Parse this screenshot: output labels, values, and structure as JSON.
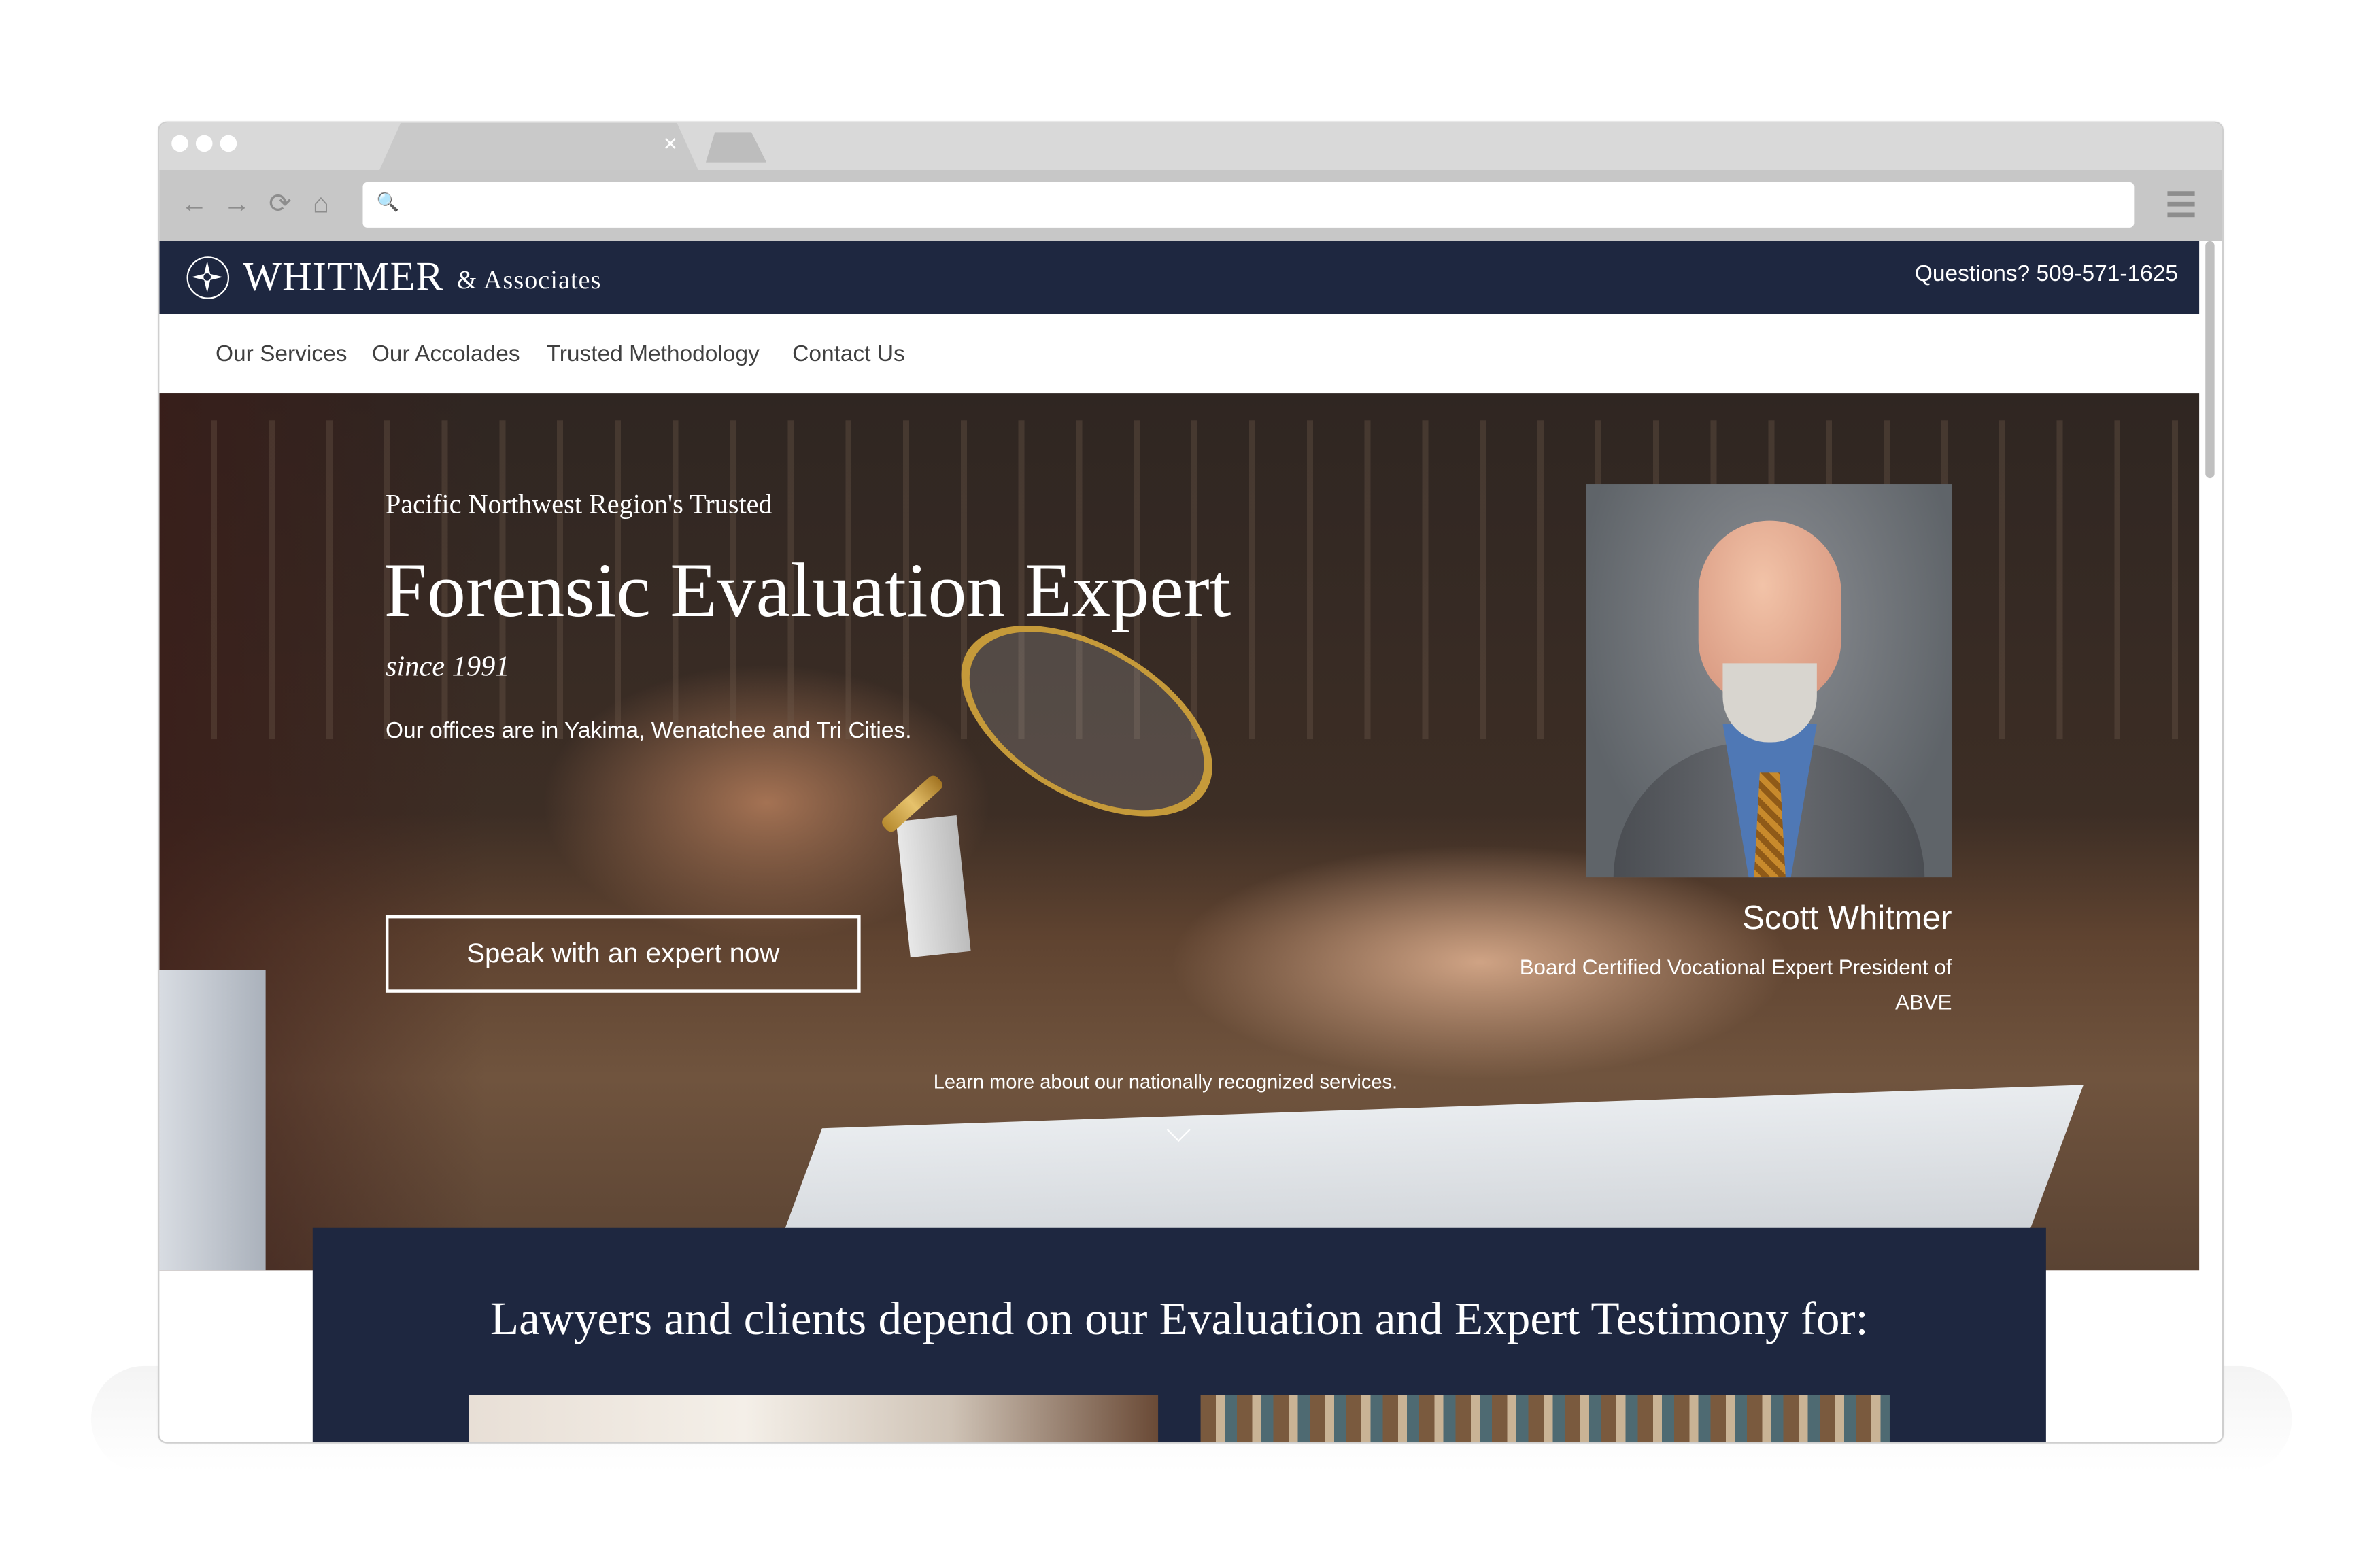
{
  "browser": {
    "tab_close_glyph": "×",
    "back_icon": "←",
    "forward_icon": "→",
    "reload_icon": "⟳",
    "home_icon": "⌂",
    "search_icon": "🔍",
    "url_value": ""
  },
  "header": {
    "logo_main": "WHITMER",
    "logo_sub": "& Associates",
    "phone": "Questions? 509-571-1625"
  },
  "nav": {
    "items": [
      {
        "label": "Our Services"
      },
      {
        "label": "Our Accolades"
      },
      {
        "label": "Trusted Methodology"
      },
      {
        "label": "Contact Us"
      }
    ]
  },
  "hero": {
    "eyebrow": "Pacific Northwest Region's Trusted",
    "headline": "Forensic Evaluation Expert",
    "since": "since 1991",
    "offices": "Our offices are in Yakima, Wenatchee and Tri Cities.",
    "cta_label": "Speak with an expert now",
    "person_name": "Scott Whitmer",
    "person_title": "Board Certified Vocational Expert President of ABVE",
    "learn_more": "Learn more about our nationally recognized services."
  },
  "services": {
    "heading": "Lawyers and clients depend on our Evaluation and Expert Testimony for:"
  },
  "colors": {
    "brand_navy": "#1e2740",
    "browser_gray": "#c7c7c7",
    "white": "#ffffff"
  }
}
